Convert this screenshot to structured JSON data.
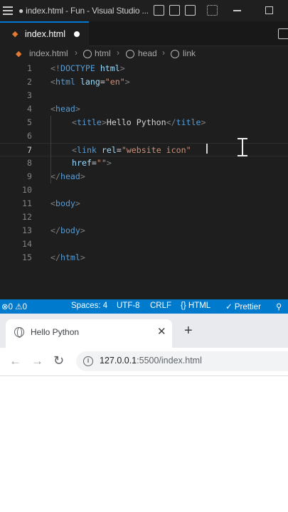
{
  "vscode": {
    "title": "● index.html - Fun - Visual Studio ...",
    "tab": {
      "label": "index.html"
    },
    "breadcrumb": [
      "index.html",
      "html",
      "head",
      "link"
    ],
    "lines": [
      {
        "n": "1",
        "parts": [
          [
            "br",
            "<!"
          ],
          [
            "tag",
            "DOCTYPE"
          ],
          [
            "txt",
            " "
          ],
          [
            "attr",
            "html"
          ],
          [
            "br",
            ">"
          ]
        ]
      },
      {
        "n": "2",
        "parts": [
          [
            "br",
            "<"
          ],
          [
            "tag",
            "html"
          ],
          [
            "txt",
            " "
          ],
          [
            "attr",
            "lang"
          ],
          [
            "txt",
            "="
          ],
          [
            "str",
            "\"en\""
          ],
          [
            "br",
            ">"
          ]
        ]
      },
      {
        "n": "3",
        "parts": []
      },
      {
        "n": "4",
        "parts": [
          [
            "br",
            "<"
          ],
          [
            "tag",
            "head"
          ],
          [
            "br",
            ">"
          ]
        ]
      },
      {
        "n": "5",
        "indent": true,
        "parts": [
          [
            "br",
            "<"
          ],
          [
            "tag",
            "title"
          ],
          [
            "br",
            ">"
          ],
          [
            "txt",
            "Hello Python"
          ],
          [
            "br",
            "</"
          ],
          [
            "tag",
            "title"
          ],
          [
            "br",
            ">"
          ]
        ]
      },
      {
        "n": "6",
        "parts": []
      },
      {
        "n": "7",
        "indent": true,
        "current": true,
        "parts": [
          [
            "br",
            "<"
          ],
          [
            "tag",
            "link"
          ],
          [
            "txt",
            " "
          ],
          [
            "attr",
            "rel"
          ],
          [
            "txt",
            "="
          ],
          [
            "str",
            "\"website icon\""
          ]
        ]
      },
      {
        "n": "8",
        "indent": true,
        "parts": [
          [
            "attr",
            "href"
          ],
          [
            "txt",
            "="
          ],
          [
            "str",
            "\"\""
          ],
          [
            "br",
            ">"
          ]
        ]
      },
      {
        "n": "9",
        "parts": [
          [
            "br",
            "</"
          ],
          [
            "tag",
            "head"
          ],
          [
            "br",
            ">"
          ]
        ]
      },
      {
        "n": "10",
        "parts": []
      },
      {
        "n": "11",
        "parts": [
          [
            "br",
            "<"
          ],
          [
            "tag",
            "body"
          ],
          [
            "br",
            ">"
          ]
        ]
      },
      {
        "n": "12",
        "parts": []
      },
      {
        "n": "13",
        "parts": [
          [
            "br",
            "</"
          ],
          [
            "tag",
            "body"
          ],
          [
            "br",
            ">"
          ]
        ]
      },
      {
        "n": "14",
        "parts": []
      },
      {
        "n": "15",
        "parts": [
          [
            "br",
            "</"
          ],
          [
            "tag",
            "html"
          ],
          [
            "br",
            ">"
          ]
        ]
      }
    ],
    "status": {
      "errors": "0",
      "warnings": "0",
      "spaces": "Spaces: 4",
      "encoding": "UTF-8",
      "eol": "CRLF",
      "language": "HTML",
      "prettier": "Prettier"
    }
  },
  "browser": {
    "tab_title": "Hello Python",
    "close_glyph": "✕",
    "new_tab_glyph": "+",
    "url_host": "127.0.0.1",
    "url_path": ":5500/index.html"
  },
  "colors": {
    "accent": "#0078d4",
    "statusbar": "#007acc",
    "html_file_icon": "#e37933"
  }
}
